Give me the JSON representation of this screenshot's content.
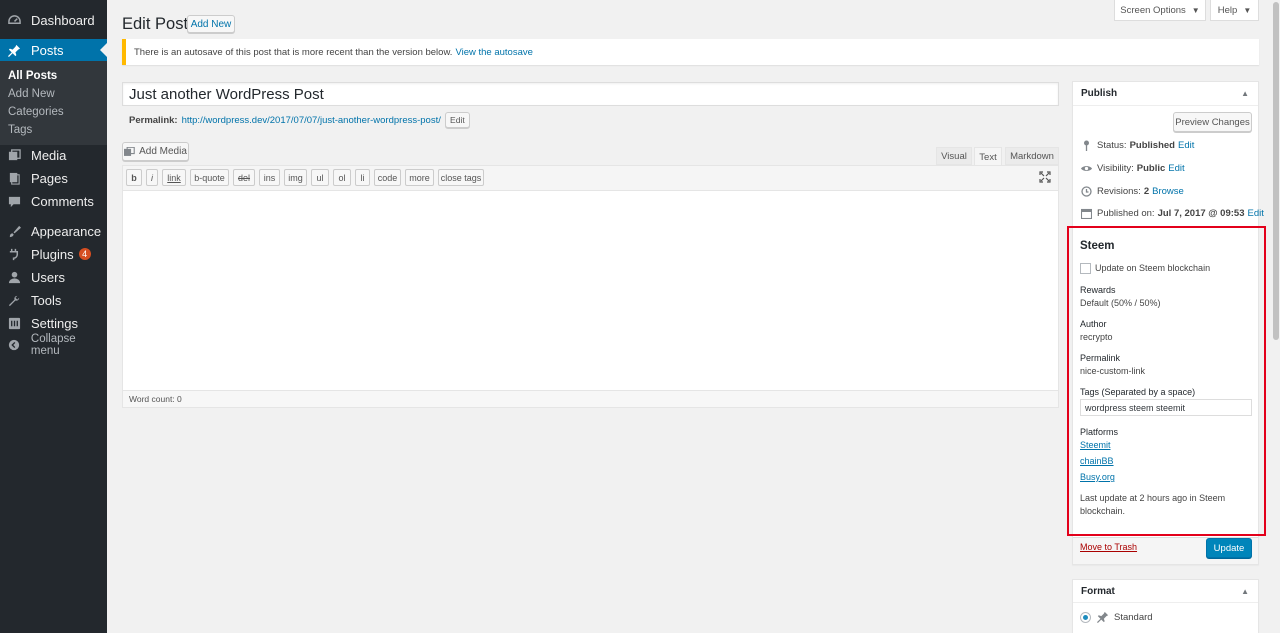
{
  "menu": {
    "dashboard": "Dashboard",
    "posts": "Posts",
    "submenu": {
      "all_posts": "All Posts",
      "add_new": "Add New",
      "categories": "Categories",
      "tags": "Tags"
    },
    "media": "Media",
    "pages": "Pages",
    "comments": "Comments",
    "appearance": "Appearance",
    "plugins": "Plugins",
    "plugins_badge": "4",
    "users": "Users",
    "tools": "Tools",
    "settings": "Settings",
    "collapse": "Collapse menu"
  },
  "top": {
    "screen_options": "Screen Options",
    "help": "Help"
  },
  "header": {
    "title": "Edit Post",
    "add_new": "Add New"
  },
  "notice": {
    "text": "There is an autosave of this post that is more recent than the version below.",
    "link": "View the autosave"
  },
  "post": {
    "title": "Just another WordPress Post",
    "permalink_label": "Permalink:",
    "permalink_base": "http://wordpress.dev/2017/07/07/",
    "permalink_slug": "just-another-wordpress-post",
    "permalink_tail": "/",
    "permalink_edit": "Edit"
  },
  "editor": {
    "add_media": "Add Media",
    "tabs": {
      "visual": "Visual",
      "text": "Text",
      "markdown": "Markdown"
    },
    "quicktags": {
      "b": "b",
      "i": "i",
      "link": "link",
      "bquote": "b-quote",
      "del": "del",
      "ins": "ins",
      "img": "img",
      "ul": "ul",
      "ol": "ol",
      "li": "li",
      "code": "code",
      "more": "more",
      "close": "close tags"
    },
    "word_count": "Word count: 0"
  },
  "publish": {
    "title": "Publish",
    "preview": "Preview Changes",
    "status_label": "Status:",
    "status_value": "Published",
    "status_edit": "Edit",
    "visibility_label": "Visibility:",
    "visibility_value": "Public",
    "visibility_edit": "Edit",
    "revisions_label": "Revisions:",
    "revisions_value": "2",
    "revisions_link": "Browse",
    "published_label": "Published on:",
    "published_value": "Jul 7, 2017 @ 09:53",
    "published_edit": "Edit",
    "trash": "Move to Trash",
    "update": "Update"
  },
  "steem": {
    "title": "Steem",
    "checkbox_label": "Update on Steem blockchain",
    "rewards_label": "Rewards",
    "rewards_value": "Default (50% / 50%)",
    "author_label": "Author",
    "author_value": "recrypto",
    "permalink_label": "Permalink",
    "permalink_value": "nice-custom-link",
    "tags_label": "Tags (Separated by a space)",
    "tags_value": "wordpress steem steemit",
    "platforms_label": "Platforms",
    "platforms": [
      "Steemit",
      "chainBB",
      "Busy.org"
    ],
    "last_update_line1": "Last update at 2 hours ago in Steem",
    "last_update_line2": "blockchain."
  },
  "format": {
    "title": "Format",
    "standard": "Standard"
  },
  "colors": {
    "accent": "#0073aa",
    "menu_bg": "#23282d",
    "highlight_box": "#e3001b",
    "trash": "#a00",
    "notice": "#ffb900"
  }
}
